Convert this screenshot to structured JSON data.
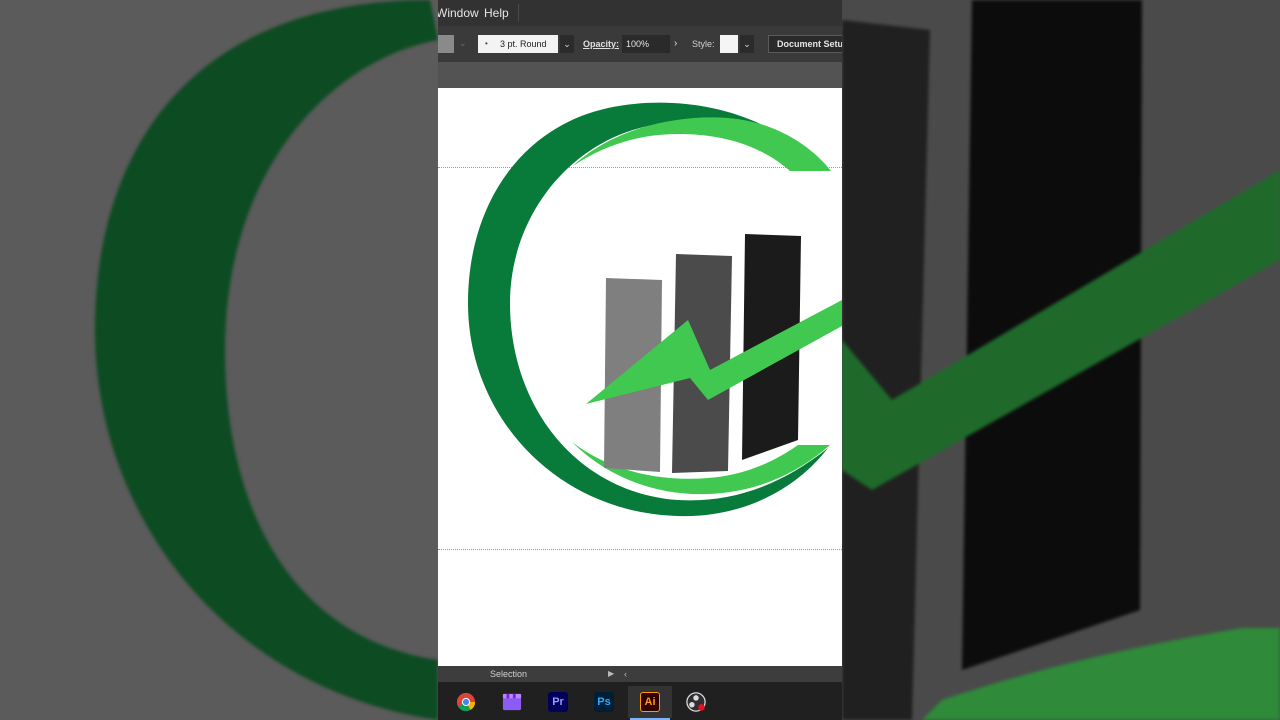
{
  "menubar": {
    "items": [
      "Window",
      "Help"
    ]
  },
  "control_bar": {
    "fill_swatch_color": "#8a8a8a",
    "stroke_profile": "3 pt. Round",
    "opacity_label": "Opacity:",
    "opacity_value": "100%",
    "style_label": "Style:",
    "document_setup_label": "Document Setup"
  },
  "logo": {
    "dark_green": "#087a3a",
    "light_green": "#40c850",
    "bar_colors": [
      "#7f7f7f",
      "#4b4b4b",
      "#1b1b1b"
    ]
  },
  "status_bar": {
    "tool_name": "Selection"
  },
  "taskbar": {
    "apps": [
      {
        "name": "chrome-icon",
        "label": ""
      },
      {
        "name": "clapper-icon",
        "label": ""
      },
      {
        "name": "premiere-icon",
        "label": "Pr"
      },
      {
        "name": "photoshop-icon",
        "label": "Ps"
      },
      {
        "name": "illustrator-icon",
        "label": "Ai",
        "active": true
      },
      {
        "name": "obs-icon",
        "label": ""
      }
    ]
  }
}
